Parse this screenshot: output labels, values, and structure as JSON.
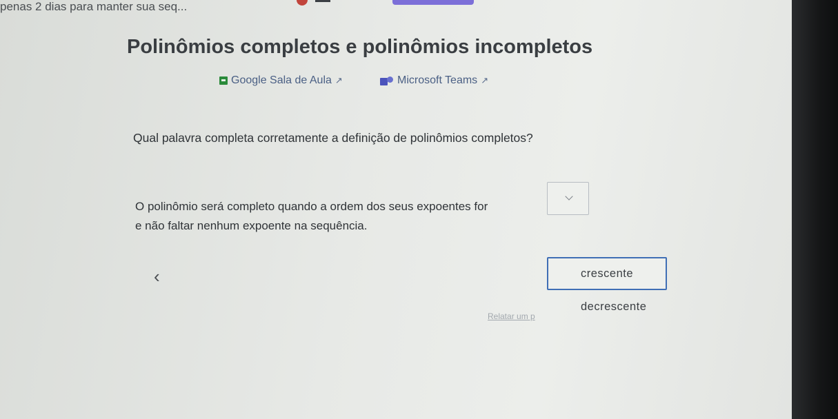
{
  "top_bar": {
    "streak_text": "penas 2 dias para manter sua seq..."
  },
  "lesson": {
    "title": "Polinômios completos e polinômios incompletos"
  },
  "share": {
    "google_classroom": "Google Sala de Aula",
    "microsoft_teams": "Microsoft Teams",
    "external_glyph": "↗"
  },
  "question": {
    "prompt": "Qual palavra completa corretamente a definição de polinômios completos?",
    "sentence_before": "O polinômio será completo quando a ordem dos seus expoentes for",
    "sentence_after": "e não faltar nenhum expoente na sequência.",
    "dropdown_selected": ""
  },
  "options": [
    {
      "label": "crescente",
      "selected": true
    },
    {
      "label": "decrescente",
      "selected": false
    }
  ],
  "nav": {
    "prev_glyph": "‹"
  },
  "report": {
    "label": "Relatar um p"
  },
  "colors": {
    "accent_purple": "#7c6fd8",
    "selected_border": "#3f6eb5",
    "link_blue": "#4a5f84",
    "classroom_green": "#2a8a3a",
    "teams_purple": "#4b53bc"
  },
  "icons": [
    "google-classroom-icon",
    "microsoft-teams-icon",
    "external-link-icon",
    "chevron-down-icon",
    "chevron-left-icon"
  ]
}
